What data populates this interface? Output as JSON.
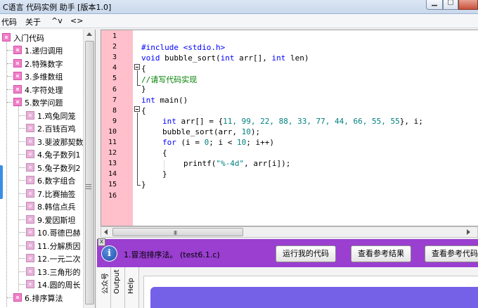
{
  "window": {
    "title": "C语言 代码实例 助手 [版本1.0]"
  },
  "menu": {
    "items": [
      "代码",
      "关于",
      "^v",
      "<>"
    ]
  },
  "tree": {
    "root": "入门代码",
    "items": [
      {
        "label": "1.递归调用",
        "level": 1
      },
      {
        "label": "2.特殊数字",
        "level": 1
      },
      {
        "label": "3.多维数组",
        "level": 1
      },
      {
        "label": "4.字符处理",
        "level": 1
      },
      {
        "label": "5.数学问题",
        "level": 1
      },
      {
        "label": "1.鸡兔同笼",
        "level": 2
      },
      {
        "label": "2.百钱百鸡",
        "level": 2
      },
      {
        "label": "3.斐波那契数",
        "level": 2
      },
      {
        "label": "4.兔子数列1",
        "level": 2
      },
      {
        "label": "5.兔子数列2",
        "level": 2
      },
      {
        "label": "6.数字组合",
        "level": 2
      },
      {
        "label": "7.比赛抽签",
        "level": 2
      },
      {
        "label": "8.韩信点兵",
        "level": 2
      },
      {
        "label": "9.爱因斯坦",
        "level": 2
      },
      {
        "label": "10.哥德巴赫",
        "level": 2
      },
      {
        "label": "11.分解质因",
        "level": 2
      },
      {
        "label": "12.一元二次",
        "level": 2
      },
      {
        "label": "13.三角形的",
        "level": 2
      },
      {
        "label": "14.圆的周长",
        "level": 2
      },
      {
        "label": "6.排序算法",
        "level": 1
      }
    ]
  },
  "editor": {
    "line_numbers": [
      "1",
      "2",
      "3",
      "4",
      "5",
      "6",
      "7",
      "8",
      "9",
      "10",
      "11",
      "12",
      "13",
      "14",
      "15",
      "16"
    ],
    "lines": {
      "l2_pp": "#include <stdio.h>",
      "l3_kw1": "void",
      "l3_a": " bubble_sort(",
      "l3_kw2": "int",
      "l3_b": " arr[], ",
      "l3_kw3": "int",
      "l3_c": " len)",
      "l5_cmt": "//请写代码实现",
      "l7_kw": "int",
      "l7_a": " main()",
      "l9_kw": "int",
      "l9_a": " arr[] = {",
      "l9_nums": "11, 99, 22, 88, 33, 77, 44, 66, 55, 55",
      "l9_b": "}, i;",
      "l10_a": "bubble_sort(arr, ",
      "l10_num": "10",
      "l10_b": ");",
      "l11_kw": "for",
      "l11_a": " (i = ",
      "l11_n1": "0",
      "l11_b": "; i < ",
      "l11_n2": "10",
      "l11_c": "; i++)",
      "l12": "{",
      "l13_a": "printf(",
      "l13_str": "\"%-4d\"",
      "l13_b": ", arr[i]);",
      "l14": "}",
      "l15": "}"
    }
  },
  "scrollbar": {
    "grip": "III"
  },
  "task": {
    "info_icon": "i",
    "description": "1.冒泡排序法。 (test6.1.c)",
    "buttons": [
      "运行我的代码",
      "查看参考结果",
      "查看参考代码"
    ],
    "close": "x"
  },
  "bottom_tabs": [
    "公众号",
    "Output",
    "Help"
  ],
  "colors": {
    "taskbar": "#9a3fd0",
    "gutter": "#ffc0cb",
    "keyword": "#0000ff",
    "comment": "#008000",
    "number": "#008080",
    "tree_icon": "#f081c8",
    "panel": "#7461e8"
  }
}
